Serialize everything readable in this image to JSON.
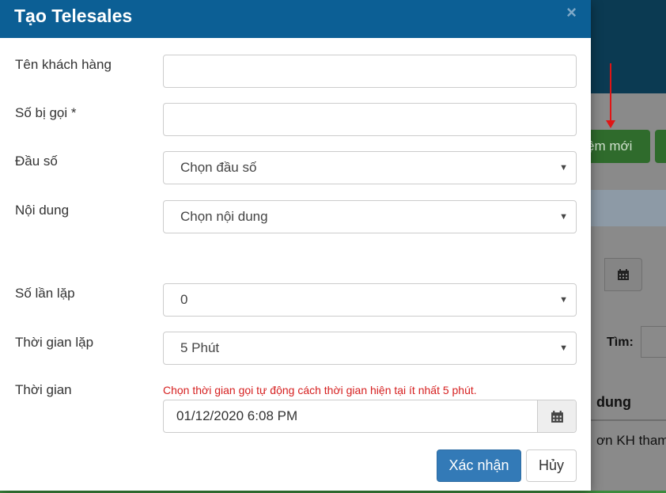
{
  "background": {
    "add_button_label": "ệm mới",
    "search_label": "Tìm:",
    "column_header": "dung",
    "row_text": "ơn KH tham"
  },
  "modal": {
    "title": "Tạo Telesales",
    "close_symbol": "×",
    "fields": {
      "customer_name": {
        "label": "Tên khách hàng",
        "value": ""
      },
      "called_number": {
        "label": "Số bị gọi *",
        "value": ""
      },
      "prefix": {
        "label": "Đầu số",
        "selected": "Chọn đầu số"
      },
      "content": {
        "label": "Nội dung",
        "selected": "Chọn nội dung"
      },
      "repeat_count": {
        "label": "Số lần lặp",
        "selected": "0"
      },
      "repeat_interval": {
        "label": "Thời gian lặp",
        "selected": "5 Phút"
      },
      "time": {
        "label": "Thời gian",
        "hint": "Chọn thời gian gọi tự động cách thời gian hiện tại ít nhất 5 phút.",
        "value": "01/12/2020 6:08 PM"
      }
    },
    "buttons": {
      "confirm": "Xác nhận",
      "cancel": "Hủy"
    }
  },
  "icons": [
    "close-icon",
    "calendar-icon",
    "caret-down-icon",
    "red-arrow"
  ],
  "colors": {
    "header": "#0c5f95",
    "primary_button": "#337ab7",
    "hint_text": "#d62020",
    "arrow": "#e01515"
  }
}
